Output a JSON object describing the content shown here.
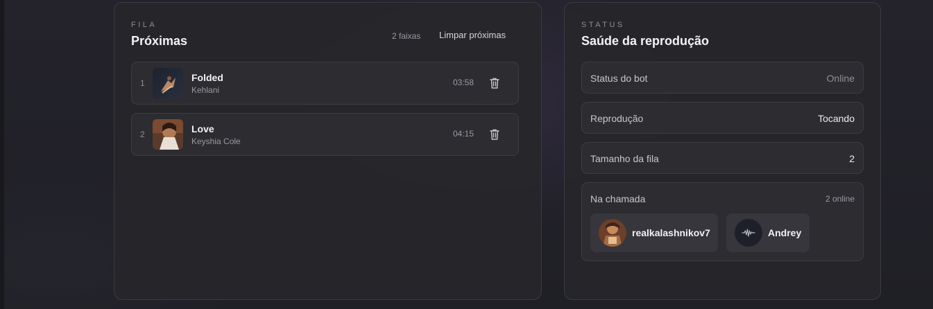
{
  "queue": {
    "eyebrow": "FILA",
    "title": "Próximas",
    "count_label": "2 faixas",
    "clear_label": "Limpar próximas",
    "tracks": [
      {
        "index": "1",
        "title": "Folded",
        "artist": "Kehlani",
        "duration": "03:58",
        "delete_icon": "trash-icon"
      },
      {
        "index": "2",
        "title": "Love",
        "artist": "Keyshia Cole",
        "duration": "04:15",
        "delete_icon": "trash-icon"
      }
    ]
  },
  "status": {
    "eyebrow": "STATUS",
    "title": "Saúde da reprodução",
    "rows": [
      {
        "label": "Status do bot",
        "value": "Online"
      },
      {
        "label": "Reprodução",
        "value": "Tocando"
      },
      {
        "label": "Tamanho da fila",
        "value": "2"
      }
    ],
    "call": {
      "label": "Na chamada",
      "online_count": "2 online",
      "members": [
        {
          "name": "realkalashnikov7",
          "avatar_icon": "user-avatar"
        },
        {
          "name": "Andrey",
          "avatar_icon": "waveform-icon"
        }
      ]
    }
  },
  "colors": {
    "background": "#1f1f25",
    "panel": "#26262b",
    "row": "#2c2c31",
    "border": "#3a3a41",
    "muted_text": "#9a9aa2"
  }
}
